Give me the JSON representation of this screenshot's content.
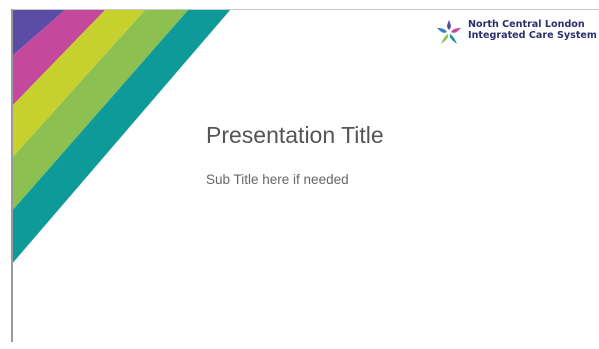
{
  "slide": {
    "title": "Presentation Title",
    "subtitle": "Sub Title here if needed"
  },
  "logo": {
    "line1": "North Central London",
    "line2": "Integrated Care System",
    "icon": "ncl-ics-star-logo-icon"
  },
  "colors": {
    "stripe_purple": "#5b4da6",
    "stripe_magenta": "#c4489c",
    "stripe_lime": "#c7d12e",
    "stripe_green": "#8cc152",
    "stripe_teal": "#0f9a9a",
    "logo_text": "#2a2d6e",
    "title_text": "#555555"
  }
}
